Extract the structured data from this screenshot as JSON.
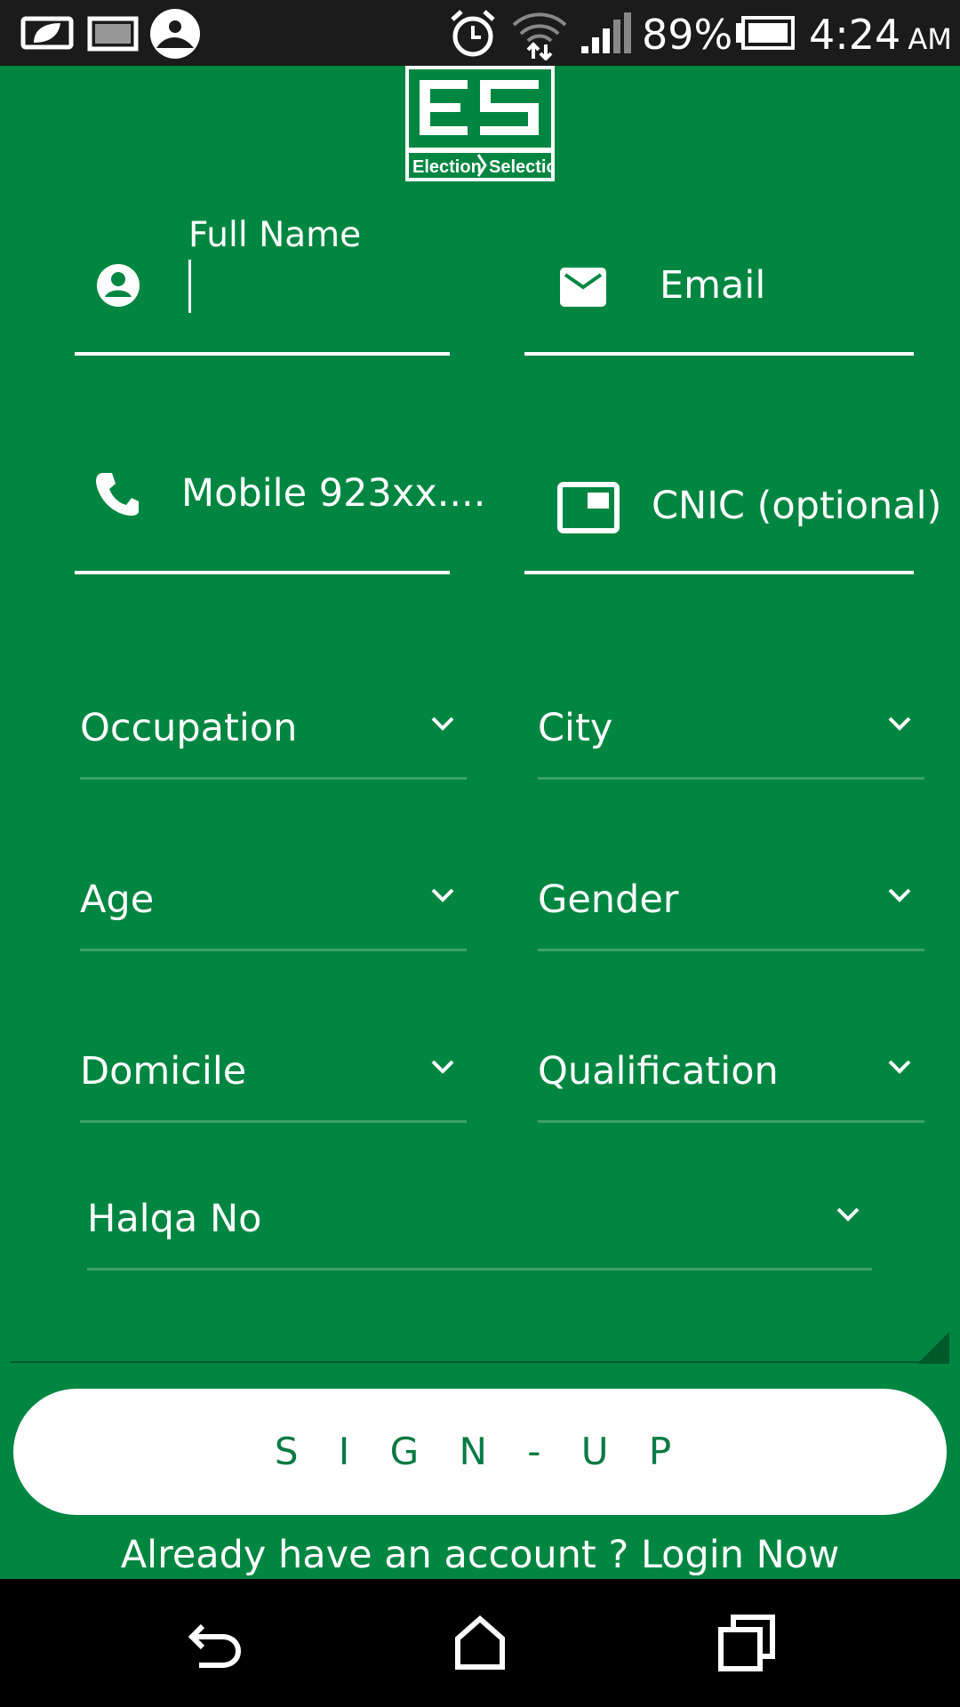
{
  "status_bar": {
    "battery_percent": "89%",
    "time": "4:24",
    "ampm": "AM"
  },
  "logo": {
    "initials": "ES",
    "left": "Election",
    "right": "Selection"
  },
  "form": {
    "full_name": {
      "label": "Full Name",
      "value": "",
      "icon": "person-icon"
    },
    "email": {
      "placeholder": "Email",
      "icon": "mail-icon"
    },
    "mobile": {
      "placeholder": "Mobile 923xx....",
      "icon": "phone-icon"
    },
    "cnic": {
      "placeholder": "CNIC (optional)",
      "icon": "card-icon"
    },
    "occupation": "Occupation",
    "city": "City",
    "age": "Age",
    "gender": "Gender",
    "domicile": "Domicile",
    "qualification": "Qualification",
    "halqa": "Halqa No"
  },
  "signup_label": "S I G N - U P",
  "login_text": "Already have an account ? Login Now",
  "colors": {
    "background": "#008641",
    "button_text": "#0a7a43",
    "status_bar": "#1b1b1b"
  }
}
